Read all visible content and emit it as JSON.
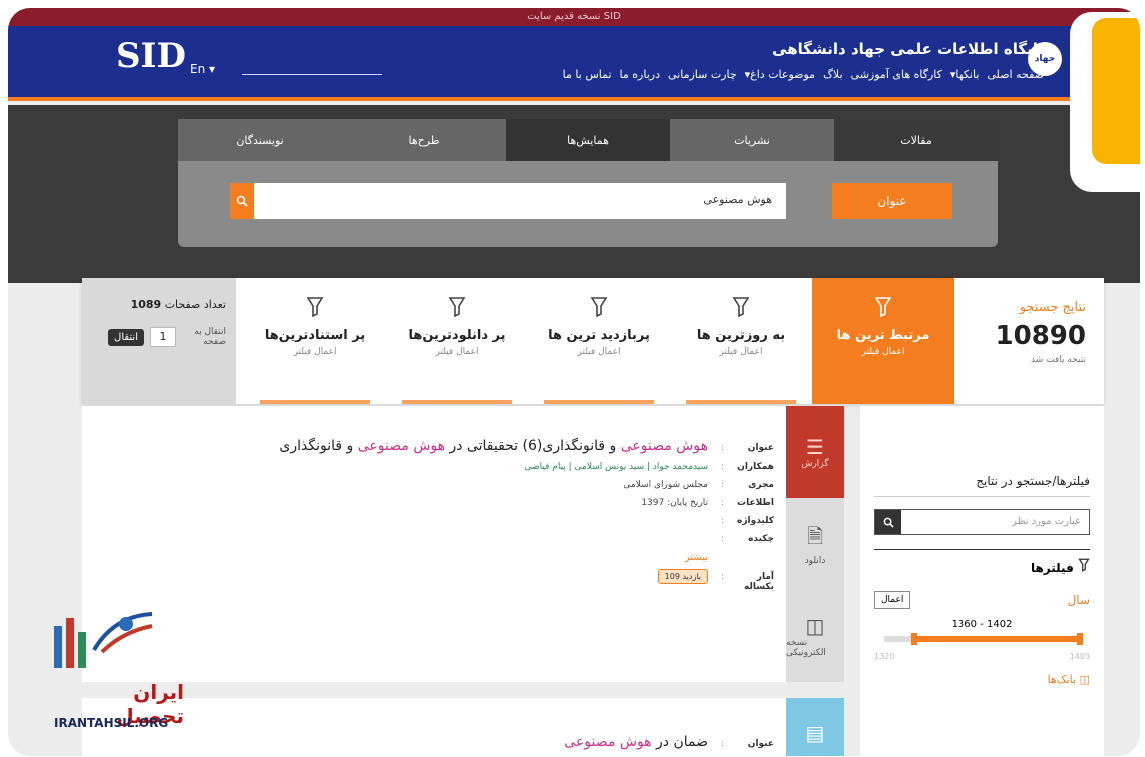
{
  "top_strip": "نسخه قدیم سایت SID",
  "header": {
    "logo": "SID",
    "lang": "En ▾",
    "site_title": "پایگاه اطلاعات علمی جهاد دانشگاهی",
    "jehad_logo": "جهاد",
    "nav": [
      "صفحه اصلی",
      "بانکها▾",
      "کارگاه های آموزشی",
      "بلاگ",
      "موضوعات داغ▾",
      "چارت سازمانی",
      "درباره ما",
      "تماس با ما"
    ]
  },
  "search": {
    "tabs": [
      "مقالات",
      "نشریات",
      "همایش‌ها",
      "طرح‌ها",
      "نویسندگان"
    ],
    "field": "عنوان",
    "query": "هوش مصنوعی"
  },
  "results": {
    "label": "نتایج جستجو",
    "count": "10890",
    "sub": "نتیجه یافت شد"
  },
  "sort_options": [
    {
      "title": "مرتبط ترین ها",
      "sub": "اعمال فیلتر"
    },
    {
      "title": "به روزترین ها",
      "sub": "اعمال فیلتر"
    },
    {
      "title": "پربازدید ترین ها",
      "sub": "اعمال فیلتر"
    },
    {
      "title": "پر دانلودترین‌ها",
      "sub": "اعمال فیلتر"
    },
    {
      "title": "پر استنادترین‌ها",
      "sub": "اعمال فیلتر"
    }
  ],
  "pages": {
    "total_label": "تعداد صفحات",
    "total": "1089",
    "goto_label": "انتقال به صفحه",
    "page": "1",
    "go": "انتقال"
  },
  "card1": {
    "title_label": "عنوان",
    "title_pre": "هوش مصنوعی",
    "title_mid": " و قانونگذاری(6) تحقیقاتی در ",
    "title_hl2": "هوش مصنوعی",
    "title_post": " و قانونگذاری",
    "authors_label": "همکاران",
    "authors": "سیدمحمد جواد | سید یونس اسلامی | پیام فیاضی",
    "source_label": "مجری",
    "source": "مجلس شورای اسلامی",
    "info_label": "اطلاعات",
    "info": "تاریخ پایان: 1397",
    "keywords_label": "کلیدواژه",
    "abstract_label": "چکیده",
    "more": "بیشتر",
    "stats_label": "آمار یکساله",
    "stats_badge": "بازدید 109",
    "actions": [
      "گزارش",
      "دانلود",
      "نسخه الکترونیکی"
    ]
  },
  "card2": {
    "title_label": "عنوان",
    "title_pre": "ضمان در ",
    "title_hl": "هوش مصنوعی"
  },
  "filters": {
    "header": "فیلترها/جستجو در نتایج",
    "search_placeholder": "عبارت مورد نظر",
    "filters_title": "فیلترها",
    "year_label": "سال",
    "apply": "اعمال",
    "range": "1360 - 1402",
    "min": "1320",
    "max": "1403",
    "banks": "بانک‌ها"
  },
  "watermark": {
    "fa": "ایران تحصیل",
    "en": "IRANTAHSIL.ORG"
  },
  "colors": {
    "accent": "#f47d20",
    "nav": "#1c2f8f",
    "badge": "#f8b400"
  }
}
